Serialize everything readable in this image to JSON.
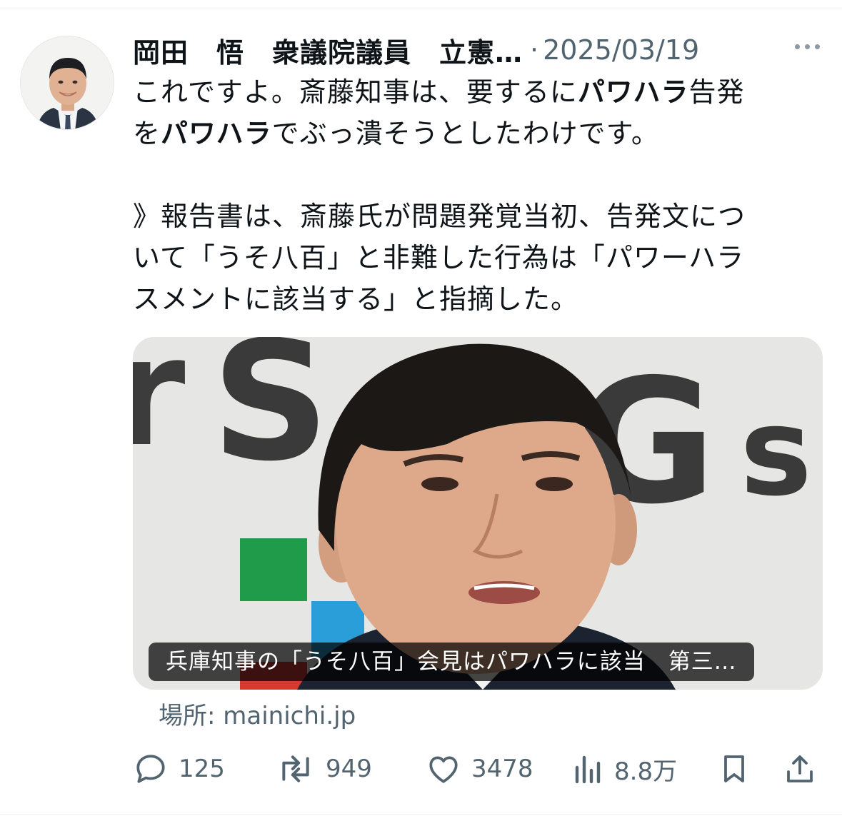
{
  "tweet": {
    "author_name": "岡田　悟　衆議院議員　立憲…",
    "separator": "·",
    "date": "2025/03/19",
    "text": {
      "line1_a": "これですよ。斎藤知事は、要するに",
      "line1_bold": "パワハラ",
      "line1_b": "告発",
      "line2_a": "を",
      "line2_bold": "パワハラ",
      "line2_b": "でぶっ潰そうとしたわけです。",
      "quote_1": "》報告書は、斎藤氏が問題発覚当初、告発文につ",
      "quote_2": "いて「うそ八百」と非難した行為は「パワーハラ",
      "quote_3": "スメントに該当する」と指摘した。"
    },
    "card": {
      "title": "兵庫知事の「うそ八百」会見はパワハラに該当　第三…",
      "source": "場所: mainichi.jp"
    },
    "actions": {
      "replies": "125",
      "retweets": "949",
      "likes": "3478",
      "views": "8.8万"
    }
  },
  "icons": {
    "more": "more-horizontal-icon",
    "reply": "reply-icon",
    "retweet": "retweet-icon",
    "like": "heart-icon",
    "views": "analytics-icon",
    "bookmark": "bookmark-icon",
    "share": "share-icon"
  },
  "colors": {
    "text": "#0f1419",
    "secondary": "#536471",
    "divider": "#eff3f4"
  }
}
